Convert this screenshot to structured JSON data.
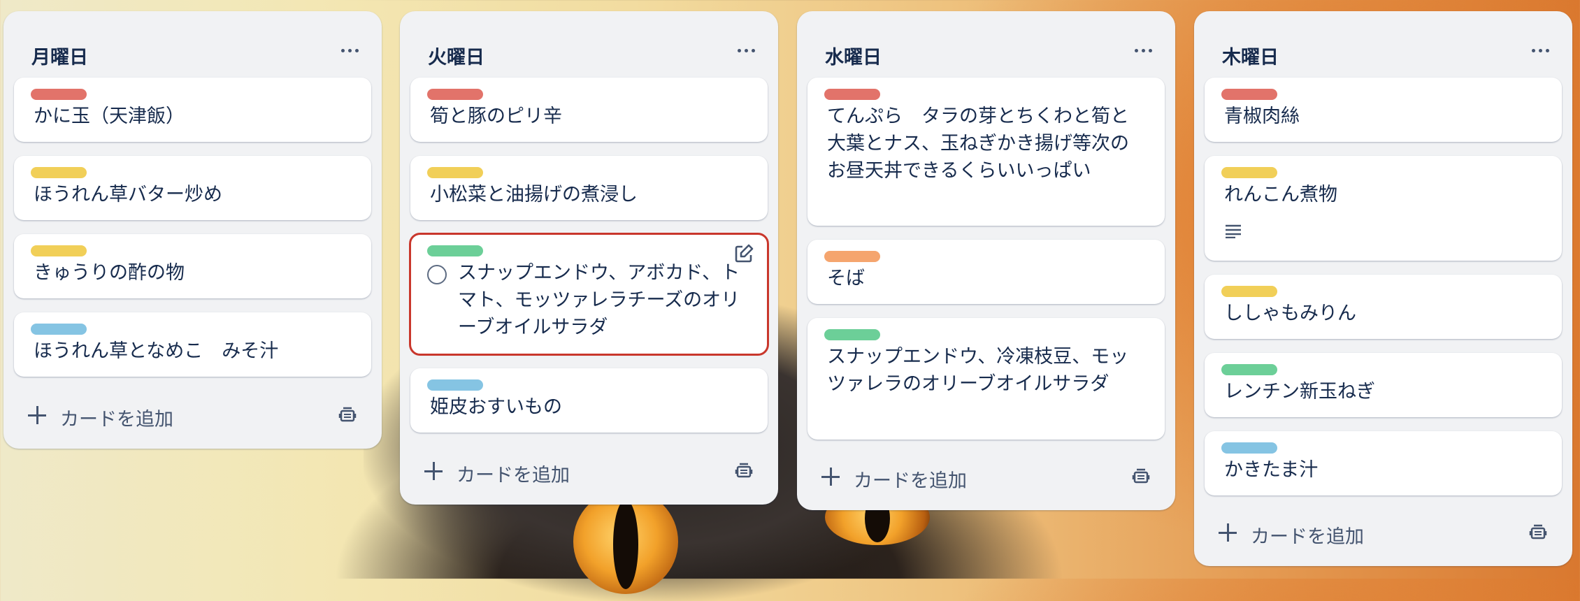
{
  "lists": [
    {
      "title": "月曜日",
      "add_label": "カードを追加",
      "cards": [
        {
          "label_color": "#e2736a",
          "title": "かに玉（天津飯）"
        },
        {
          "label_color": "#f1cf58",
          "title": "ほうれん草バター炒め"
        },
        {
          "label_color": "#f1cf58",
          "title": "きゅうりの酢の物"
        },
        {
          "label_color": "#85c4e3",
          "title": "ほうれん草となめこ　みそ汁"
        }
      ]
    },
    {
      "title": "火曜日",
      "add_label": "カードを追加",
      "cards": [
        {
          "label_color": "#e2736a",
          "title": "筍と豚のピリ辛"
        },
        {
          "label_color": "#f1cf58",
          "title": "小松菜と油揚げの煮浸し"
        },
        {
          "label_color": "#6ccf98",
          "title": "スナップエンドウ、アボカド、トマト、モッツァレラチーズのオリーブオイルサラダ",
          "selected": true
        },
        {
          "label_color": "#85c4e3",
          "title": "姫皮おすいもの"
        }
      ]
    },
    {
      "title": "水曜日",
      "add_label": "カードを追加",
      "cards": [
        {
          "label_color": "#e2736a",
          "title": "てんぷら　タラの芽とちくわと筍と大葉とナス、玉ねぎかき揚げ等次のお昼天丼できるくらいいっぱい"
        },
        {
          "label_color": "#f5a56e",
          "title": "そば"
        },
        {
          "label_color": "#6ccf98",
          "title": "スナップエンドウ、冷凍枝豆、モッツァレラのオリーブオイルサラダ"
        }
      ]
    },
    {
      "title": "木曜日",
      "add_label": "カードを追加",
      "cards": [
        {
          "label_color": "#e2736a",
          "title": "青椒肉絲"
        },
        {
          "label_color": "#f1cf58",
          "title": "れんこん煮物",
          "has_description": true
        },
        {
          "label_color": "#f1cf58",
          "title": "ししゃもみりん"
        },
        {
          "label_color": "#6ccf98",
          "title": "レンチン新玉ねぎ"
        },
        {
          "label_color": "#85c4e3",
          "title": "かきたま汁"
        }
      ]
    }
  ],
  "icons": {
    "list_menu": "more-horizontal-icon",
    "add": "plus-icon",
    "template": "card-template-icon",
    "edit": "edit-icon",
    "complete": "circle-check-icon",
    "description": "description-lines-icon"
  }
}
